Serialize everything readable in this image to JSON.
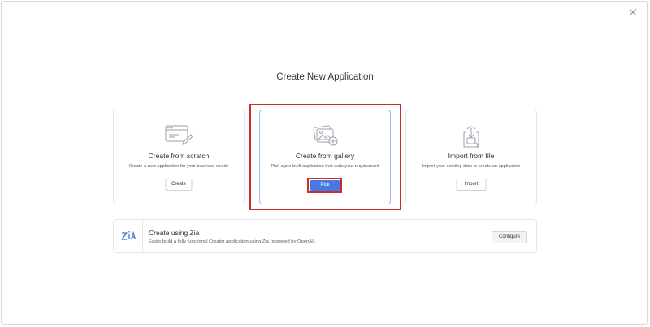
{
  "dialog": {
    "title": "Create New Application"
  },
  "icons": {
    "close": "close-icon",
    "scratch": "browser-edit-icon",
    "gallery": "image-gallery-add-icon",
    "import": "file-import-icon",
    "zia": "zia-logo-icon"
  },
  "cards": [
    {
      "title": "Create from scratch",
      "description": "Create a new application for your business needs",
      "button": "Create"
    },
    {
      "title": "Create from gallery",
      "description": "Pick a pre-built application that suits your requirement",
      "button": "Pick"
    },
    {
      "title": "Import from file",
      "description": "Import your existing data to create an application",
      "button": "Import"
    }
  ],
  "zia": {
    "logo_text": "Zia",
    "title": "Create using Zia",
    "description": "Easily build a fully functional Creator application using Zia (powered by OpenAI).",
    "button": "Configure"
  },
  "colors": {
    "accent": "#4a78e3",
    "highlight": "#c62f2f",
    "gallery_border": "#9dbcf0"
  }
}
